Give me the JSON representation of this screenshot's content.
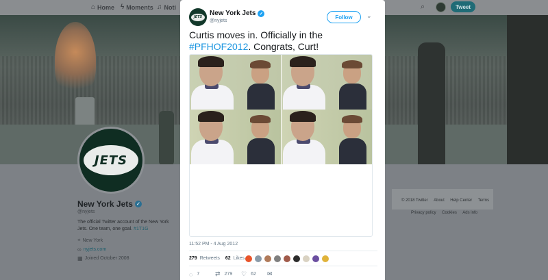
{
  "nav": {
    "home": "Home",
    "moments": "Moments",
    "notifications": "Noti",
    "tweet_button": "Tweet",
    "icons": [
      "home-icon",
      "lightning-icon",
      "bell-icon",
      "search-icon"
    ]
  },
  "profile": {
    "name": "New York Jets",
    "handle": "@nyjets",
    "bio": "The official Twitter account of the New York Jets. One team, one goal.",
    "bio_hashtag": "#1T1G",
    "location": "New York",
    "website": "nyjets.com",
    "joined": "Joined October 2008",
    "avatar_text": "JETS"
  },
  "footer": {
    "links": [
      "© 2018 Twitter",
      "About",
      "Help Center",
      "Terms",
      "Privacy policy",
      "Cookies",
      "Ads info"
    ]
  },
  "tweet": {
    "author_name": "New York Jets",
    "author_handle": "@nyjets",
    "follow_label": "Follow",
    "text": "Curtis moves in. Officially in the ",
    "hashtag": "#PFHOF2012",
    "text_after": ". Congrats, Curt!",
    "timestamp": "11:52 PM - 4 Aug 2012",
    "retweets_count": "279",
    "retweets_label": "Retweets",
    "likes_count": "62",
    "likes_label": "Likes",
    "reply_count": "7",
    "retweet_count_action": "279",
    "like_count_action": "62",
    "liker_colors": [
      "#e8542a",
      "#8a9aa8",
      "#b07a5a",
      "#7f7f7f",
      "#a05a4a",
      "#2b2b2b",
      "#d9d2c2",
      "#6b4fa0",
      "#e0b33a"
    ]
  },
  "colors": {
    "accent": "#1da1f2",
    "hashtag": "#1b95e0",
    "jets_green": "#12382a"
  }
}
